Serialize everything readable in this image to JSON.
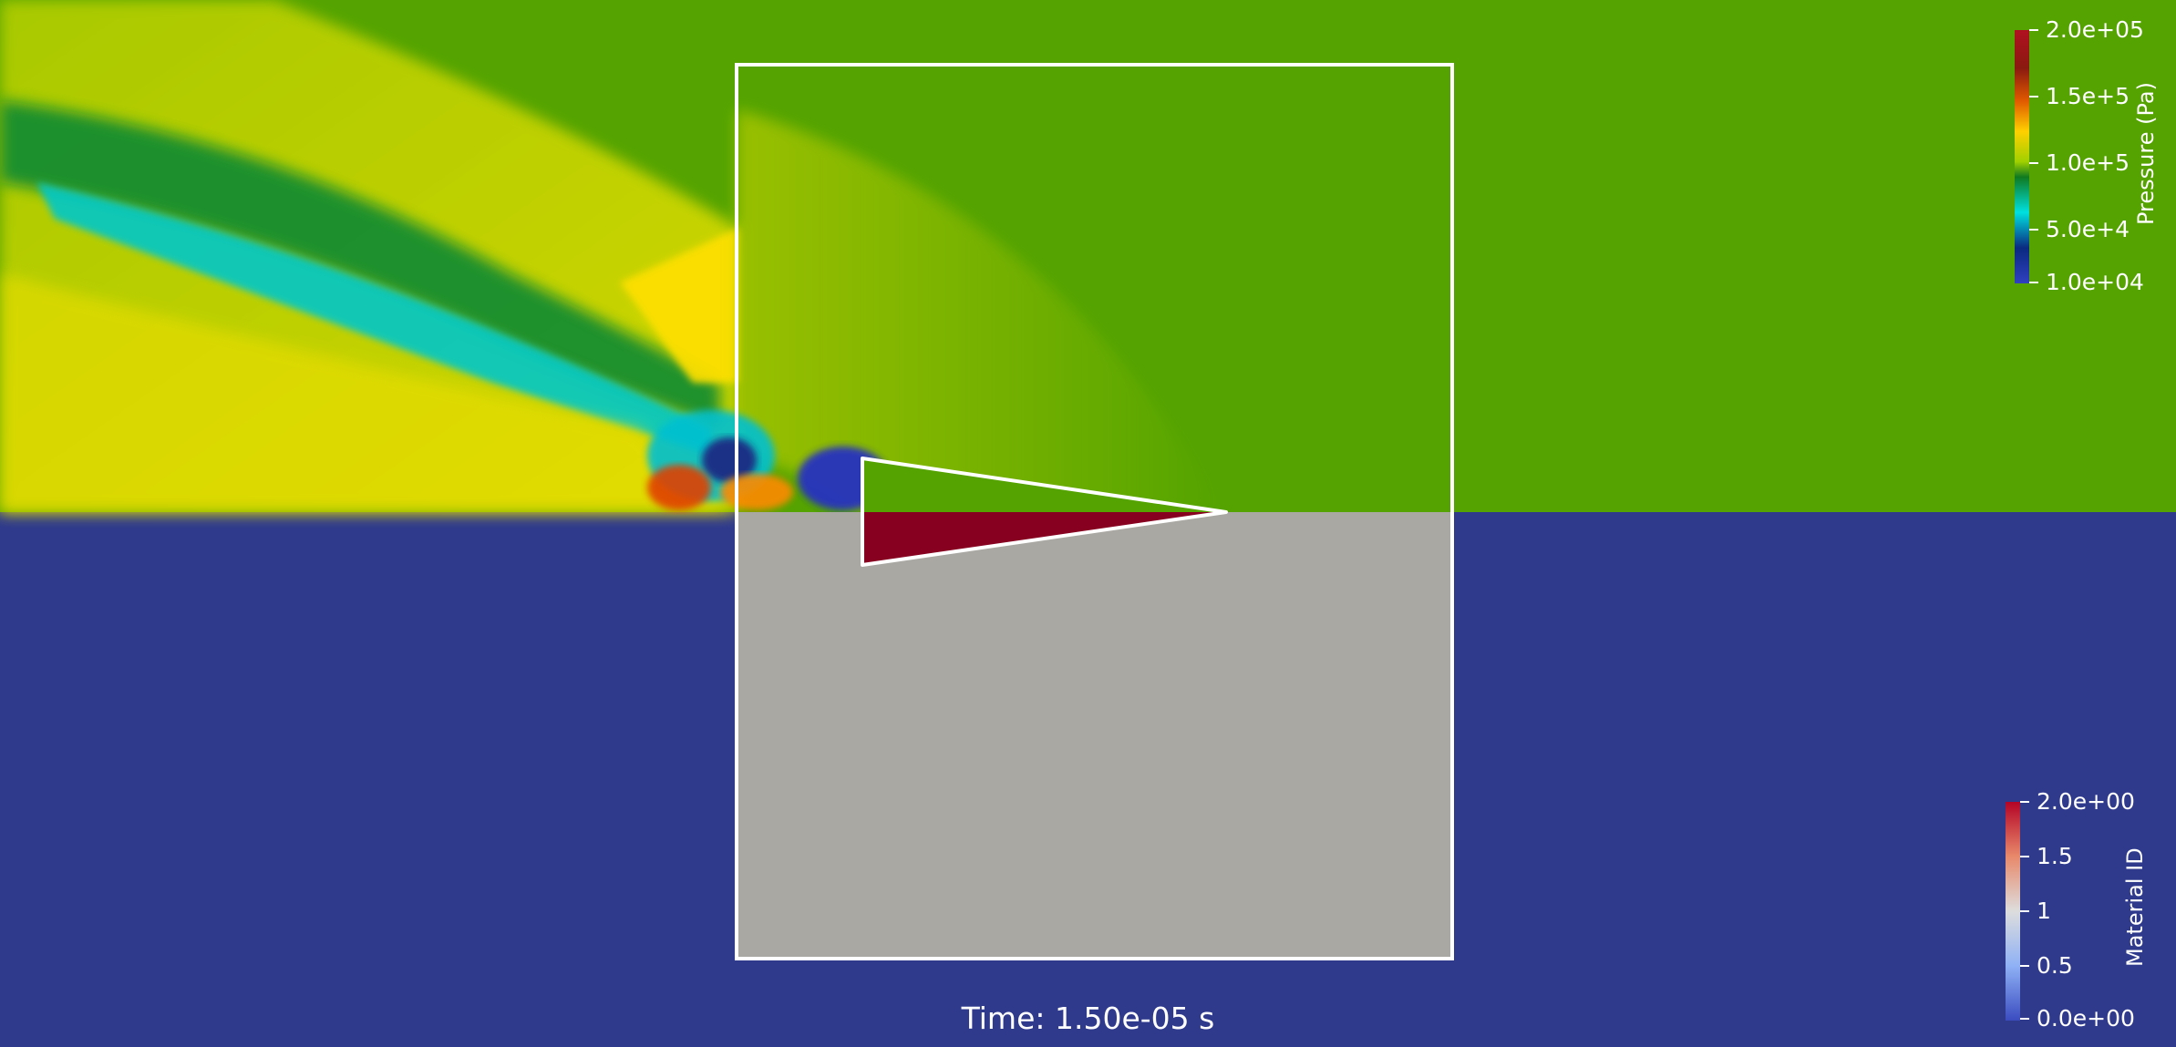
{
  "colors": {
    "background": "#2f3a8d",
    "pressure_ambient": "#54a300",
    "material_region": "#aaa8a2",
    "material_solid": "#870020",
    "outline": "#ffffff"
  },
  "pressure_legend": {
    "title": "Pressure (Pa)",
    "ticks": [
      "2.0e+05",
      "1.5e+5",
      "1.0e+5",
      "5.0e+4",
      "1.0e+04"
    ],
    "range": [
      10000,
      200000
    ]
  },
  "material_legend": {
    "title": "Material ID",
    "ticks": [
      "2.0e+00",
      "1.5",
      "1",
      "0.5",
      "0.0e+00"
    ],
    "range": [
      0,
      2
    ]
  },
  "time_label": "Time: 1.50e-05 s"
}
